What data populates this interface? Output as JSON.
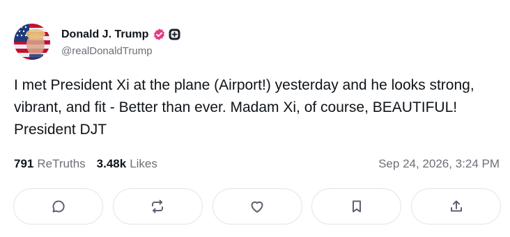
{
  "author": {
    "display_name": "Donald J. Trump",
    "handle": "@realDonaldTrump",
    "avatar_icon": "flag-portrait-avatar",
    "verified_icon": "verified-badge-icon",
    "verified_color": "#e53b83",
    "plus_icon": "plus-badge-icon"
  },
  "post": {
    "text": "I met President Xi at the plane (Airport!) yesterday and he looks strong, vibrant, and fit - Better than ever. Madam Xi, of course, BEAUTIFUL! President DJT"
  },
  "stats": {
    "retruths_count": "791",
    "retruths_label": "ReTruths",
    "likes_count": "3.48k",
    "likes_label": "Likes",
    "timestamp": "Sep 24, 2026, 3:24 PM"
  },
  "actions": [
    {
      "name": "reply",
      "icon": "comment-icon"
    },
    {
      "name": "retruth",
      "icon": "repost-icon"
    },
    {
      "name": "like",
      "icon": "heart-icon"
    },
    {
      "name": "bookmark",
      "icon": "bookmark-icon"
    },
    {
      "name": "share",
      "icon": "share-icon"
    }
  ],
  "colors": {
    "text_primary": "#0f1419",
    "text_secondary": "#6b6f76",
    "button_border": "#e2e4e8",
    "icon_color": "#5b6270"
  }
}
